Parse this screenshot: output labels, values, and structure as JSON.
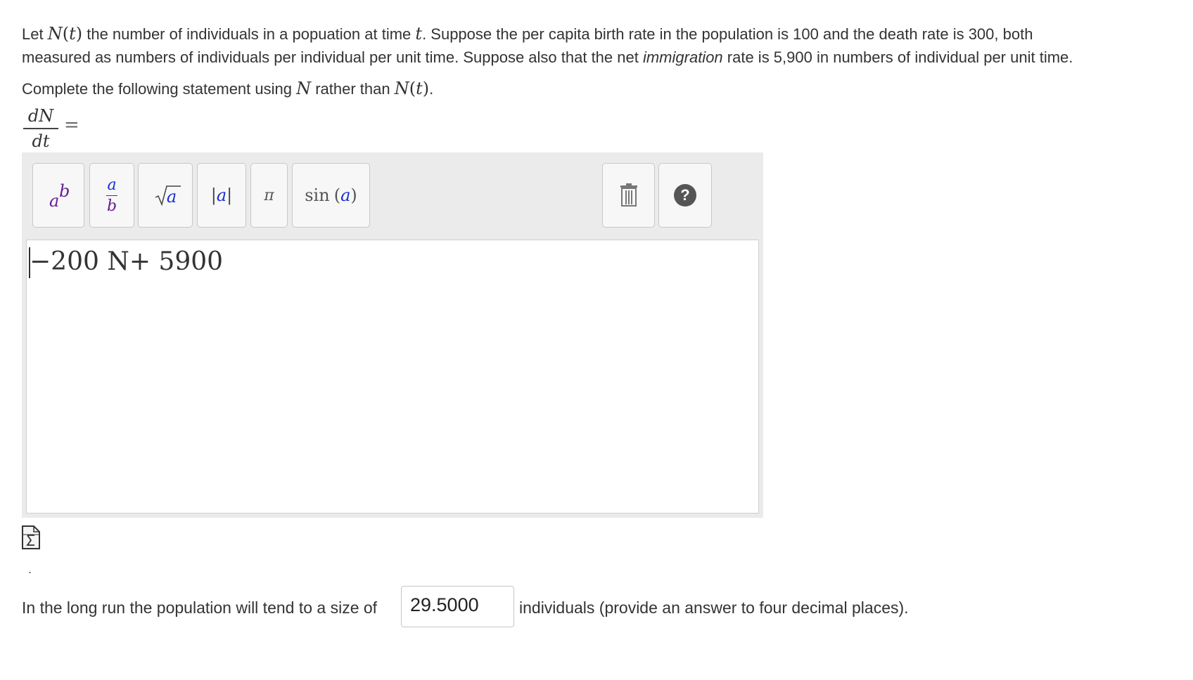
{
  "question": {
    "p1_before": "Let ",
    "N": "N",
    "t_open": "(",
    "t": "t",
    "t_close": ")",
    "p1_mid": " the number of individuals in a popuation at time ",
    "p1_after": ". Suppose the per capita birth rate in the population is 100 and the death rate is 300, both",
    "p2_before": "measured as numbers of individuals per individual per unit time. Suppose also that the net ",
    "p2_em": "immigration",
    "p2_after": " rate is 5,900 in numbers of individual per unit time.",
    "p3_before": "Complete the following statement using ",
    "p3_mid": " rather than ",
    "p3_end": "."
  },
  "lhs": {
    "numerator": "dN",
    "denominator": "dt",
    "equals": "="
  },
  "toolbar": {
    "power_base": "a",
    "power_exp": "b",
    "fraction_num": "a",
    "fraction_den": "b",
    "sqrt_arg": "a",
    "abs_arg": "a",
    "pi": "π",
    "sin_label": "sin",
    "sin_arg": "a",
    "help": "?"
  },
  "answer_expression": "−200 N+ 5900",
  "long_run": {
    "before": "In the long run the population will tend to a size of",
    "value": "29.5000",
    "after": "individuals (provide an answer to four decimal places)."
  },
  "dot": "."
}
